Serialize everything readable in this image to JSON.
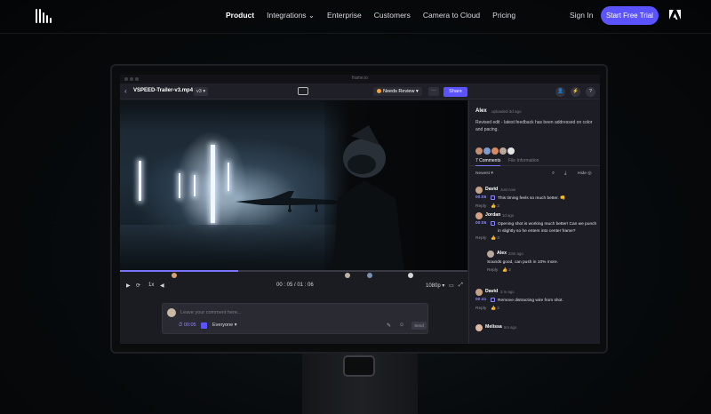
{
  "nav": {
    "menu": [
      "Product",
      "Integrations",
      "Enterprise",
      "Customers",
      "Camera to Cloud",
      "Pricing"
    ],
    "integrations_caret": "⌄",
    "signin": "Sign In",
    "cta": "Start Free Trial",
    "brand_color": "#5b53ff"
  },
  "app": {
    "window_title": "frame.io",
    "file_name": "VSPEED-Trailer-v3.mp4",
    "version": "v3 ▾",
    "status": "Needs Review ▾",
    "more": "···",
    "share": "Share",
    "icons": [
      "person-icon",
      "bolt-icon",
      "help-icon"
    ],
    "icon_glyphs": [
      "👤",
      "⚡",
      "?"
    ]
  },
  "player": {
    "progress": 0.34,
    "speed": "1x",
    "timecode": "00 : 05  /  01 : 06",
    "quality": "1080p ▾"
  },
  "composer": {
    "placeholder": "Leave your comment here...",
    "time": "⏱ 00:05",
    "visibility": "Everyone ▾",
    "send": "Send"
  },
  "panel": {
    "author": "Alex",
    "meta": "uploaded 3d ago",
    "description": "Revised edit - latest feedback has been addressed on color and pacing.",
    "tabs": [
      "7 Comments",
      "File Information"
    ],
    "sort": "Newest ▾",
    "hide": "Hide",
    "comments": [
      {
        "name": "David",
        "age": "Just now",
        "time": "00:05",
        "text": "This timing feels so much better. 👊",
        "reply": "Reply",
        "likes": "👍 2"
      },
      {
        "name": "Jordan",
        "age": "1d ago",
        "time": "00:05",
        "text": "Opening shot is working much better! Can we punch in slightly so he enters into center frame?",
        "reply": "Reply",
        "likes": "👍 3"
      },
      {
        "name": "Alex",
        "age": "23m ago",
        "time": "",
        "text": "Sounds good, can push in 10% more.",
        "reply": "Reply",
        "likes": "👍 2"
      },
      {
        "name": "David",
        "age": "3 m ago",
        "time": "00:41",
        "text": "Remove distracting wire from shot.",
        "reply": "Reply",
        "likes": "👍 2"
      },
      {
        "name": "Melissa",
        "age": "5m ago",
        "time": "",
        "text": "",
        "reply": "",
        "likes": ""
      }
    ]
  }
}
